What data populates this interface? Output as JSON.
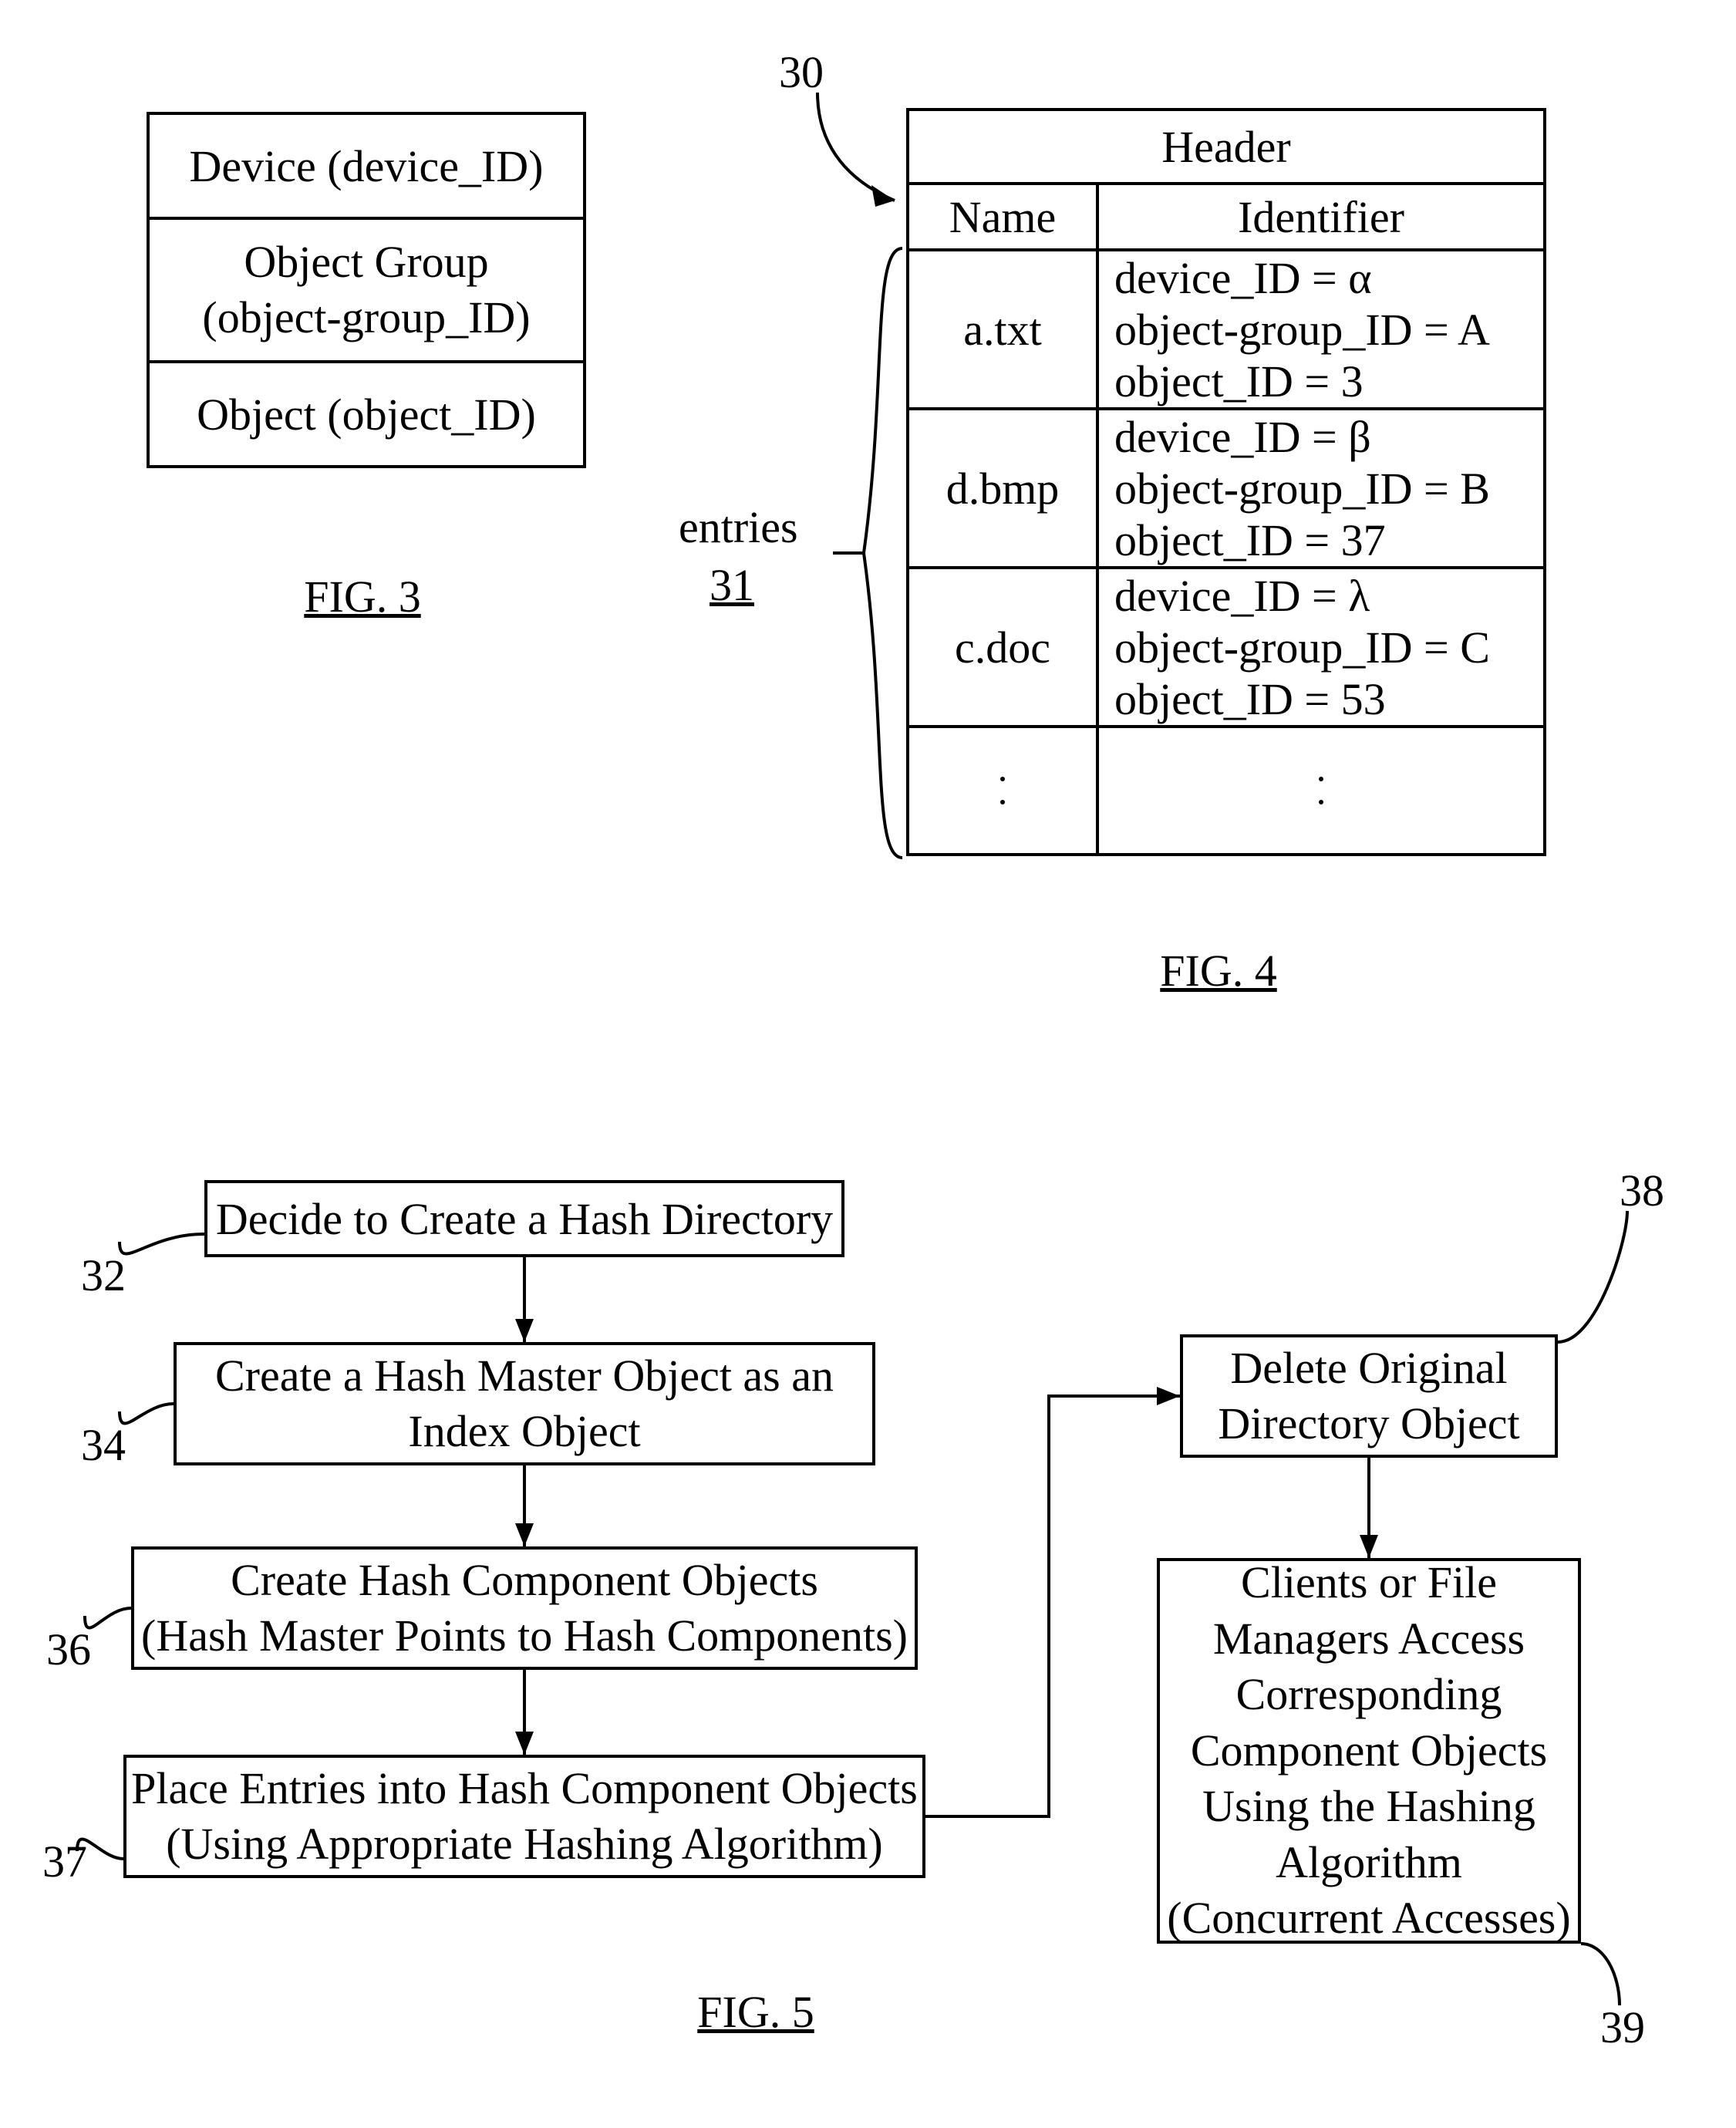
{
  "fig3": {
    "caption": "FIG. 3",
    "rows": [
      "Device (device_ID)",
      "Object Group\n(object-group_ID)",
      "Object (object_ID)"
    ]
  },
  "fig4": {
    "caption": "FIG. 4",
    "refTop": "30",
    "entriesLabel": "entries",
    "entriesRef": "31",
    "header": "Header",
    "colName": "Name",
    "colIdentifier": "Identifier",
    "rows": [
      {
        "name": "a.txt",
        "lines": [
          "device_ID = α",
          "object-group_ID = A",
          "object_ID = 3"
        ]
      },
      {
        "name": "d.bmp",
        "lines": [
          "device_ID = β",
          "object-group_ID = B",
          "object_ID = 37"
        ]
      },
      {
        "name": "c.doc",
        "lines": [
          "device_ID = λ",
          "object-group_ID = C",
          "object_ID = 53"
        ]
      }
    ]
  },
  "fig5": {
    "caption": "FIG. 5",
    "steps": {
      "s32": {
        "ref": "32",
        "text": "Decide to Create a Hash Directory"
      },
      "s34": {
        "ref": "34",
        "text": "Create a Hash Master Object as an\nIndex Object"
      },
      "s36": {
        "ref": "36",
        "text": "Create Hash Component Objects\n(Hash Master Points to Hash Components)"
      },
      "s37": {
        "ref": "37",
        "text": "Place Entries into Hash Component Objects\n(Using Appropriate Hashing Algorithm)"
      },
      "s38": {
        "ref": "38",
        "text": "Delete Original\nDirectory Object"
      },
      "s39": {
        "ref": "39",
        "text": "Clients or File\nManagers Access\nCorresponding\nComponent Objects\nUsing the Hashing\nAlgorithm\n(Concurrent Accesses)"
      }
    }
  }
}
